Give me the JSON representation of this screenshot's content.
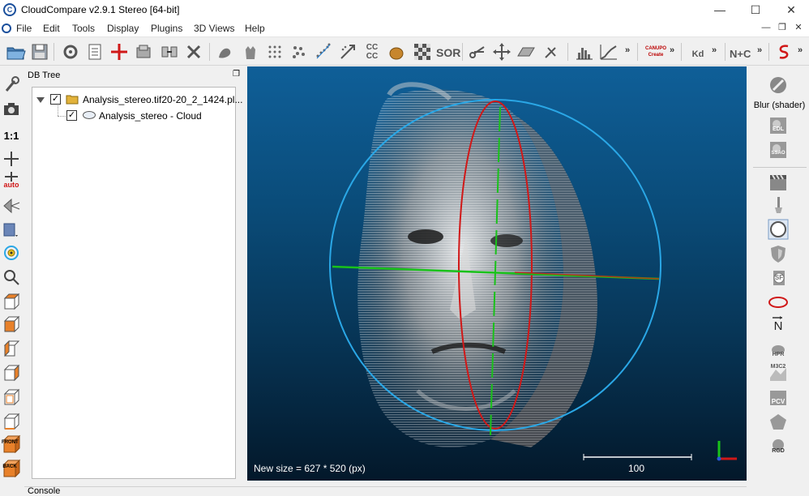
{
  "window": {
    "title": "CloudCompare v2.9.1 Stereo [64-bit]"
  },
  "menu": {
    "items": [
      "File",
      "Edit",
      "Tools",
      "Display",
      "Plugins",
      "3D Views",
      "Help"
    ]
  },
  "toolbar": {
    "ccc_text": "CC\nCC",
    "sor_text": "SOR",
    "canupo_text": "CANUPO Create",
    "kd_text": "Kd",
    "nc_text": "N+C",
    "chevron": "»"
  },
  "left_toolbar": {
    "one_to_one": "1:1",
    "auto": "auto",
    "front": "FRONT",
    "back": "BACK"
  },
  "db_tree": {
    "title": "DB Tree",
    "file_node": "Analysis_stereo.tif20-20_2_1424.pl...",
    "cloud_node": "Analysis_stereo - Cloud"
  },
  "view": {
    "status_text": "New size = 627 * 520 (px)",
    "scale_value": "100"
  },
  "right_toolbar": {
    "blur_label": "Blur (shader)",
    "edl": "EDL",
    "ssao": "SSAO",
    "sf": "SF",
    "n_label": "N",
    "hpr": "HPR",
    "m3c2": "M3C2",
    "pcv": "PCV",
    "rgd": "RGD"
  },
  "console": {
    "title": "Console"
  },
  "colors": {
    "accent": "#1a4f9c",
    "view_top": "#0f5f98",
    "view_bottom": "#03182a",
    "sphere": "#2aa7e6",
    "axis_red": "#d01818",
    "axis_green": "#19c21a"
  }
}
